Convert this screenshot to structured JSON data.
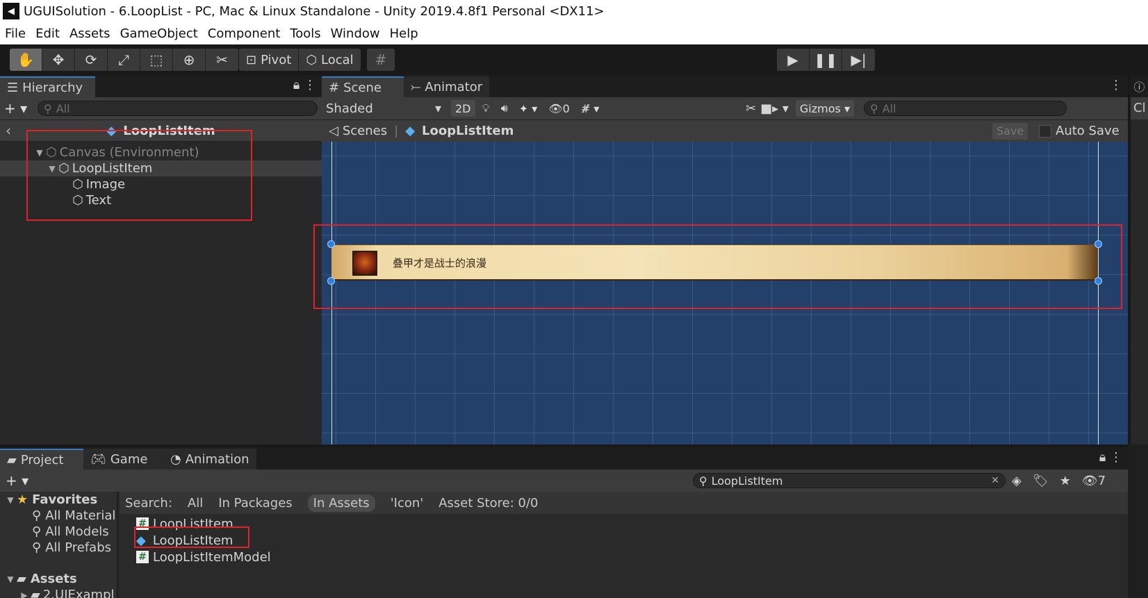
{
  "window": {
    "title": "UGUISolution - 6.LoopList - PC, Mac & Linux Standalone - Unity 2019.4.8f1 Personal <DX11>"
  },
  "menu": [
    "File",
    "Edit",
    "Assets",
    "GameObject",
    "Component",
    "Tools",
    "Window",
    "Help"
  ],
  "toolbar": {
    "pivot_label": "Pivot",
    "local_label": "Local"
  },
  "hierarchy": {
    "tab_label": "Hierarchy",
    "search_placeholder": "All",
    "prefab_name": "LoopListItem",
    "tree": [
      {
        "label": "Canvas (Environment)"
      },
      {
        "label": "LoopListItem"
      },
      {
        "label": "Image"
      },
      {
        "label": "Text"
      }
    ]
  },
  "scene": {
    "tabs": [
      "Scene",
      "Animator"
    ],
    "shading_mode": "Shaded",
    "mode_2d": "2D",
    "hidden_count": "0",
    "gizmos_label": "Gizmos",
    "search_placeholder": "All",
    "breadcrumb_root": "Scenes",
    "breadcrumb_prefab": "LoopListItem",
    "save_label": "Save",
    "auto_save_label": "Auto Save",
    "item_text": "叠甲才是战士的浪漫"
  },
  "right_strip_label": "Cl",
  "project": {
    "tabs": [
      "Project",
      "Game",
      "Animation"
    ],
    "search_value": "LoopListItem",
    "hidden_count": "7",
    "search_label": "Search:",
    "search_scopes": [
      "All",
      "In Packages",
      "In Assets",
      "'Icon'",
      "Asset Store: 0/0"
    ],
    "favorites_label": "Favorites",
    "favorites": [
      "All Material",
      "All Models",
      "All Prefabs"
    ],
    "assets_label": "Assets",
    "assets_child": "2.UIExampl",
    "results": [
      {
        "label": "LoopListItem"
      },
      {
        "label": "LoopListItem"
      },
      {
        "label": "LoopListItemModel"
      }
    ]
  },
  "colors": {
    "highlight_box": "#e0222a",
    "active_tab_accent": "#3a79bb",
    "scene_background": "#23406a"
  }
}
